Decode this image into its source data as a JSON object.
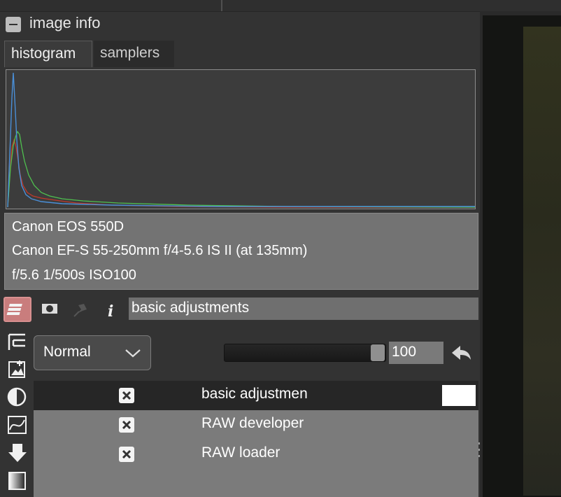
{
  "panel": {
    "title": "image info"
  },
  "tabs": [
    {
      "label": "histogram",
      "active": true
    },
    {
      "label": "samplers",
      "active": false
    }
  ],
  "histogram": {
    "colors": {
      "blue": "#4a8fd8",
      "green": "#4fc04f",
      "red": "#c0392b"
    }
  },
  "exif": {
    "camera": "Canon EOS 550D",
    "lens": "Canon EF-S 55-250mm f/4-5.6 IS II (at 135mm)",
    "exposure": "f/5.6  1/500s  ISO100"
  },
  "module_header": {
    "name": "basic adjustments",
    "icons": [
      "layers-icon",
      "mask-icon",
      "pin-icon",
      "info-icon"
    ]
  },
  "blend": {
    "mode": "Normal",
    "opacity_value": "100",
    "opacity_level": 1.0
  },
  "side_icons": [
    "tree-icon",
    "image-add-icon",
    "contrast-icon",
    "curve-icon",
    "pipette-icon",
    "gradient-icon"
  ],
  "layers": [
    {
      "label": "basic adjustmen",
      "enabled": true,
      "selected": true,
      "has_thumb": true
    },
    {
      "label": "RAW developer",
      "enabled": true,
      "selected": false,
      "has_thumb": false
    },
    {
      "label": "RAW loader",
      "enabled": true,
      "selected": false,
      "has_thumb": false
    }
  ],
  "colors": {
    "background": "#333333",
    "active_module": "#c97d7d"
  }
}
